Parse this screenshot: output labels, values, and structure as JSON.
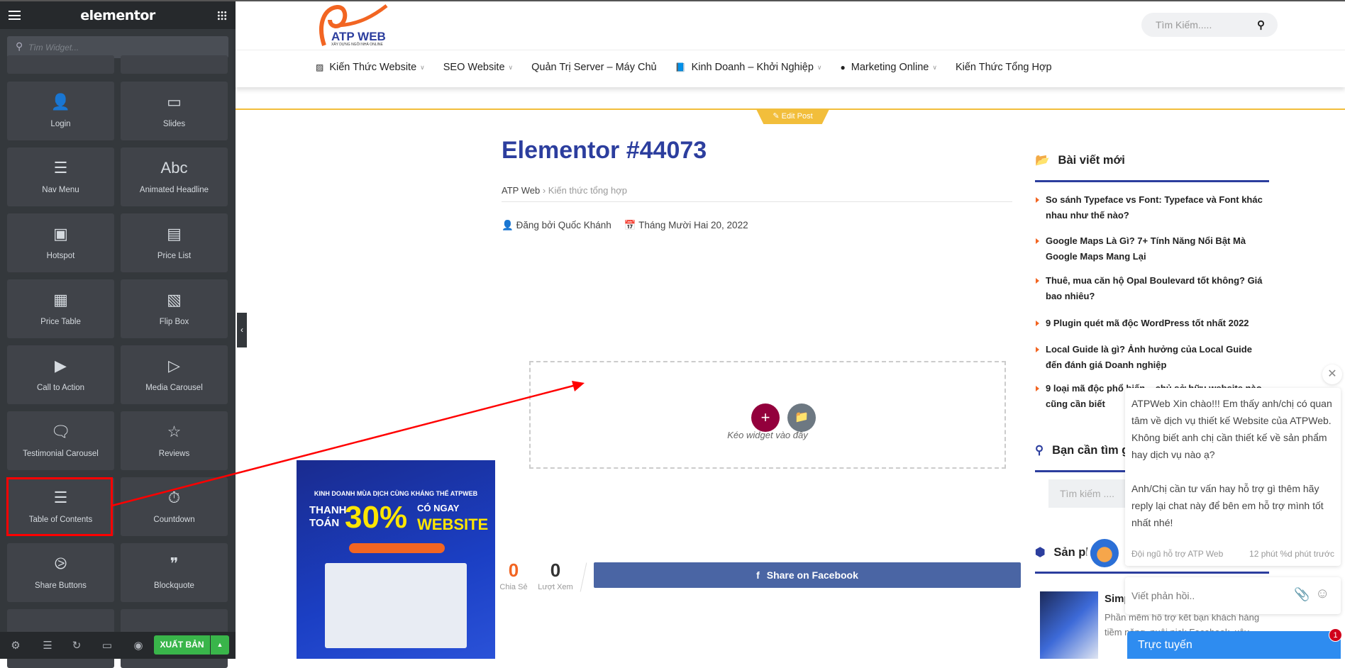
{
  "editor": {
    "brand": "elementor",
    "search_placeholder": "Tìm Widget...",
    "widgets": [
      {
        "label": "Login",
        "icon": "login-icon"
      },
      {
        "label": "Slides",
        "icon": "slides-icon"
      },
      {
        "label": "Nav Menu",
        "icon": "nav-menu-icon"
      },
      {
        "label": "Animated Headline",
        "icon": "animated-headline-icon"
      },
      {
        "label": "Hotspot",
        "icon": "hotspot-icon"
      },
      {
        "label": "Price List",
        "icon": "price-list-icon"
      },
      {
        "label": "Price Table",
        "icon": "price-table-icon"
      },
      {
        "label": "Flip Box",
        "icon": "flip-box-icon"
      },
      {
        "label": "Call to Action",
        "icon": "call-to-action-icon"
      },
      {
        "label": "Media Carousel",
        "icon": "media-carousel-icon"
      },
      {
        "label": "Testimonial Carousel",
        "icon": "testimonial-carousel-icon"
      },
      {
        "label": "Reviews",
        "icon": "reviews-icon"
      },
      {
        "label": "Table of Contents",
        "icon": "table-of-contents-icon"
      },
      {
        "label": "Countdown",
        "icon": "countdown-icon"
      },
      {
        "label": "Share Buttons",
        "icon": "share-icon"
      },
      {
        "label": "Blockquote",
        "icon": "blockquote-icon"
      }
    ],
    "publish_label": "XUẤT BẢN",
    "highlight_color": "#ff0000"
  },
  "site": {
    "logo_text": "ATP WEB",
    "logo_tagline": "XÂY DỰNG NGÔI NHÀ ONLINE",
    "search_placeholder": "Tìm Kiếm.....",
    "nav": [
      {
        "label": "Kiến Thức Website",
        "icon": "share-square-icon",
        "dropdown": true
      },
      {
        "label": "SEO Website",
        "dropdown": true
      },
      {
        "label": "Quản Trị Server – Máy Chủ",
        "dropdown": false
      },
      {
        "label": "Kinh Doanh – Khởi Nghiệp",
        "icon": "book-icon",
        "dropdown": true
      },
      {
        "label": "Marketing Online",
        "icon": "globe-icon",
        "dropdown": true
      },
      {
        "label": "Kiến Thức Tổng Hợp",
        "dropdown": false
      }
    ],
    "edit_post": "Edit Post"
  },
  "post": {
    "title": "Elementor #44073",
    "breadcrumb": [
      "ATP Web",
      "Kiến thức tổng hợp"
    ],
    "author": "Đăng bởi Quốc Khánh",
    "date": "Tháng Mười Hai 20, 2022",
    "dropzone_text": "Kéo widget vào đây",
    "shares": {
      "value": "0",
      "label": "Chia Sẻ"
    },
    "views": {
      "value": "0",
      "label": "Lượt Xem"
    },
    "facebook_label": "Share on Facebook"
  },
  "sidebar": {
    "recent_title": "Bài viết mới",
    "recent_posts": [
      "So sánh Typeface vs Font: Typeface và Font khác nhau như thế nào?",
      "Google Maps Là Gì? 7+ Tính Năng Nổi Bật Mà Google Maps Mang Lại",
      "Thuê, mua căn hộ Opal Boulevard tốt không? Giá bao nhiêu?",
      "9 Plugin quét mã độc WordPress tốt nhất 2022",
      "Local Guide là gì? Ảnh hưởng của Local Guide đến đánh giá Doanh nghiệp",
      "9 loại mã độc phổ biến – chủ sở hữu website nào cũng cần biết"
    ],
    "search_title": "Bạn cần tìm gì",
    "search_placeholder": "Tìm kiếm ....",
    "products_title": "Sản phẩm",
    "product_title": "Simple",
    "product_desc": "Phần mềm hỗ trợ kết bạn khách hàng tiềm năng, nuôi nick Facebook, xây"
  },
  "chat": {
    "message": "ATPWeb Xin chào!!! Em thấy anh/chị có quan tâm về dịch vụ thiết kế Website của ATPWeb. Không biết anh chị cần thiết kế về sản phẩm hay dịch vụ nào ạ?\n\nAnh/Chị cần tư vấn hay hỗ trợ gì thêm hãy reply lại chat này để bên em hỗ trợ mình tốt nhất nhé!",
    "sender": "Đội ngũ hỗ trợ ATP Web",
    "time": "12 phút %d phút trước",
    "reply_placeholder": "Viết phản hồi..",
    "status": "Trực tuyến",
    "unread": "1"
  }
}
